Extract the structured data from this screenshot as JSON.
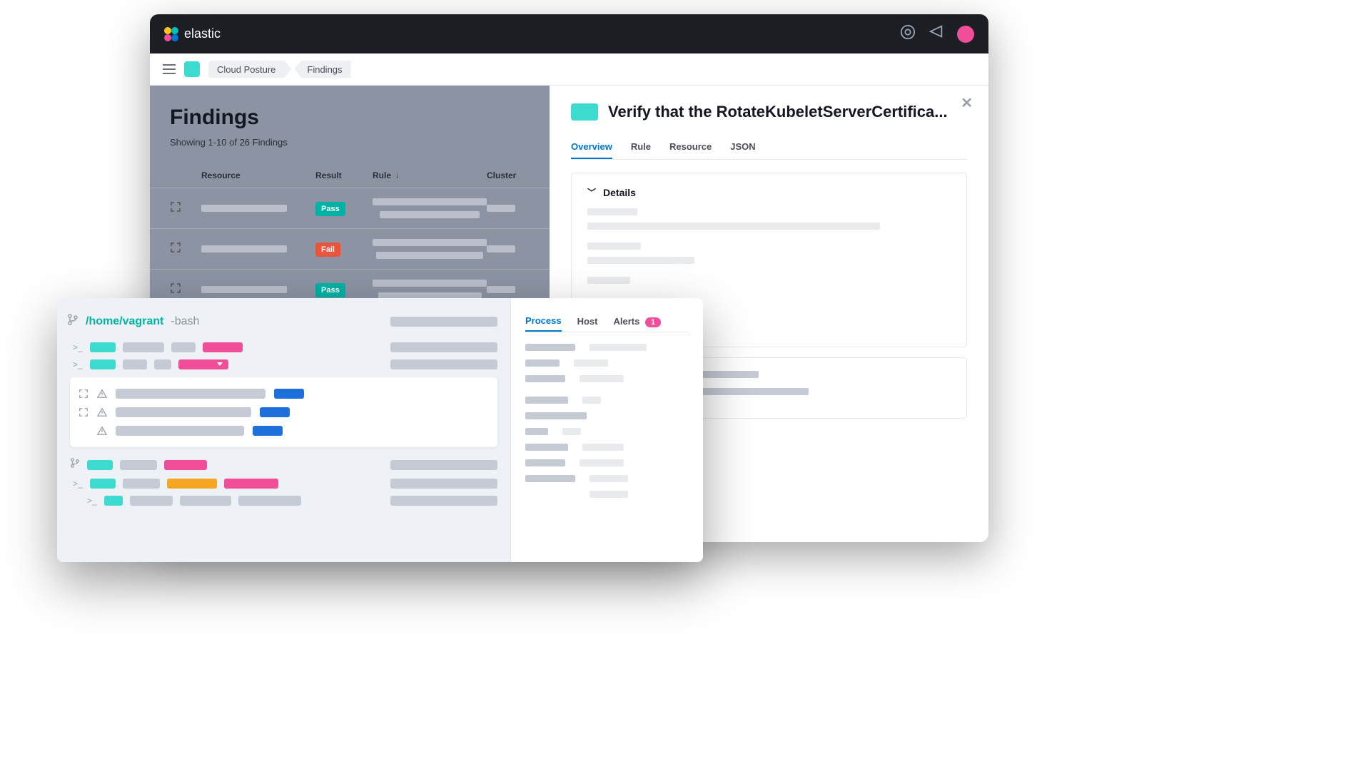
{
  "brand": "elastic",
  "breadcrumbs": {
    "first": "Cloud Posture",
    "last": "Findings"
  },
  "findings": {
    "title": "Findings",
    "subtitle": "Showing 1-10 of 26 Findings",
    "columns": {
      "resource": "Resource",
      "result": "Result",
      "rule": "Rule",
      "cluster": "Cluster"
    },
    "rows": [
      {
        "result": "Pass"
      },
      {
        "result": "Fail"
      },
      {
        "result": "Pass"
      }
    ]
  },
  "flyout": {
    "title": "Verify that the RotateKubeletServerCertifica...",
    "tabs": {
      "overview": "Overview",
      "rule": "Rule",
      "resource": "Resource",
      "json": "JSON"
    },
    "details_label": "Details"
  },
  "session": {
    "path": "/home/vagrant",
    "shell": "-bash",
    "tabs": {
      "process": "Process",
      "host": "Host",
      "alerts": "Alerts"
    },
    "alerts_count": "1"
  }
}
